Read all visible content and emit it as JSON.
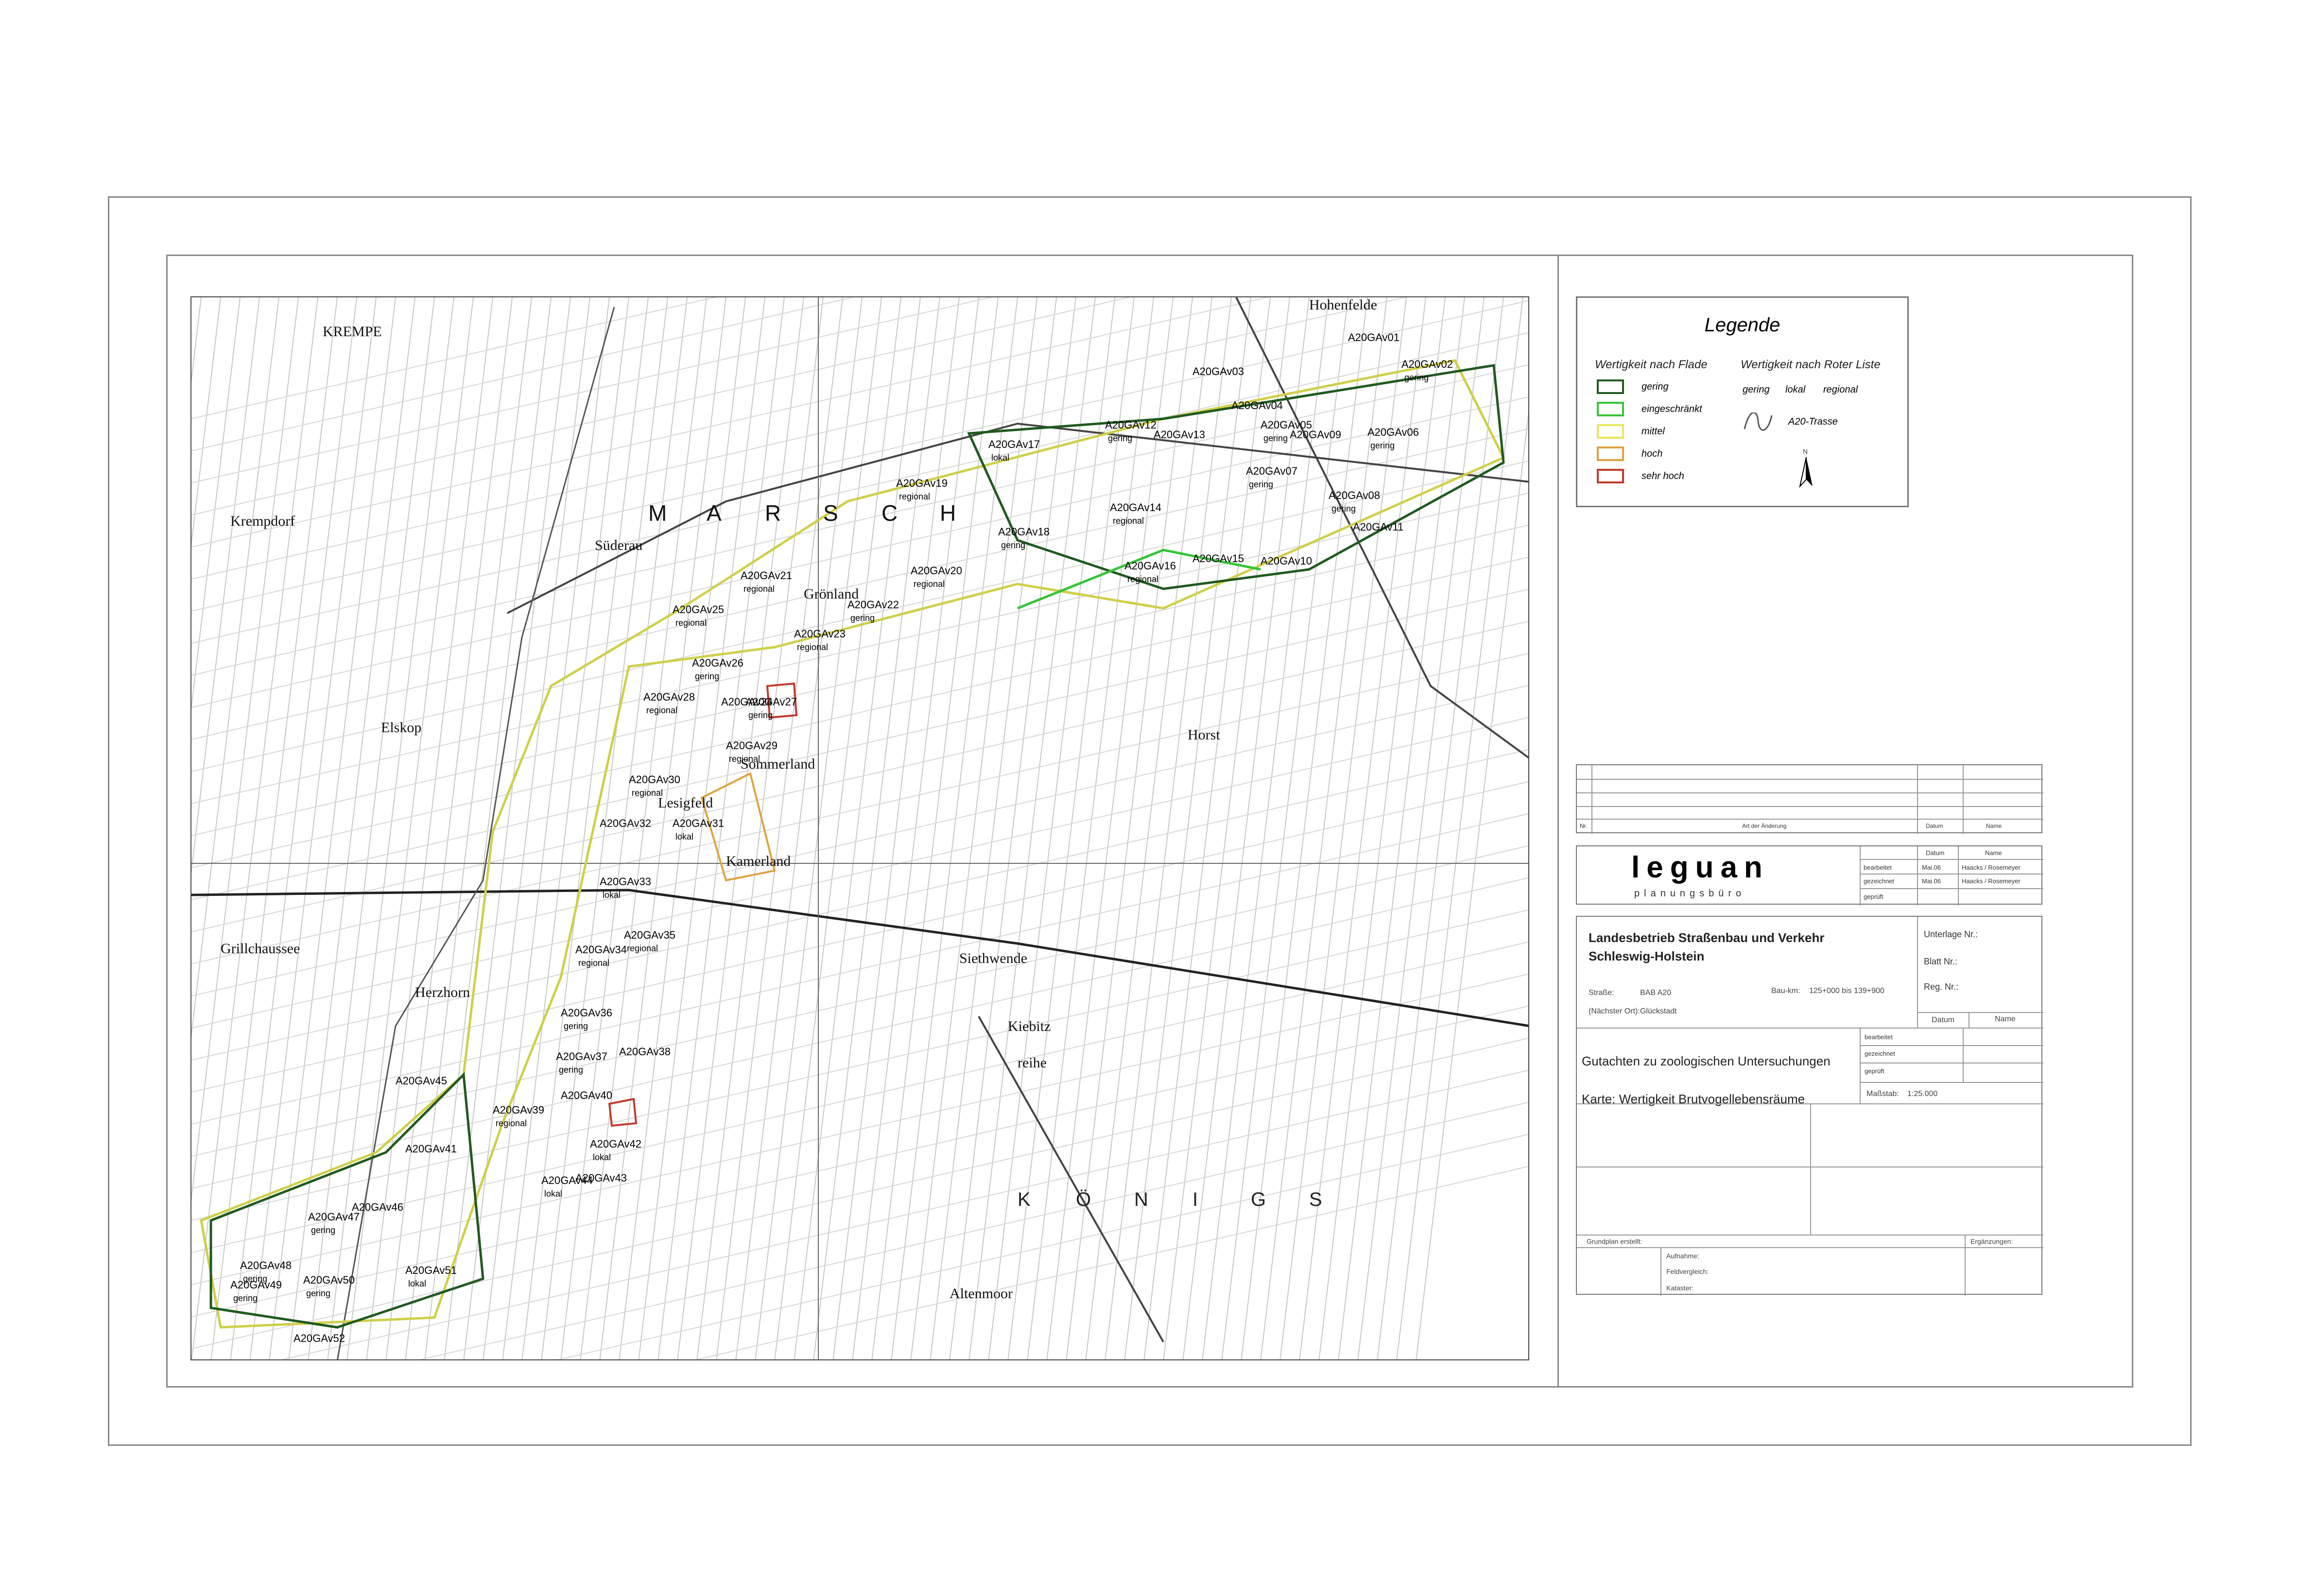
{
  "legend": {
    "title": "Legende",
    "header_flade": "Wertigkeit nach Flade",
    "header_rote_liste": "Wertigkeit nach Roter Liste",
    "categories": [
      {
        "label": "gering",
        "color": "#1f5a1f"
      },
      {
        "label": "eingeschränkt",
        "color": "#36c436"
      },
      {
        "label": "mittel",
        "color": "#e6e65a"
      },
      {
        "label": "hoch",
        "color": "#e0a040"
      },
      {
        "label": "sehr hoch",
        "color": "#c0392b"
      }
    ],
    "rote_liste_levels": [
      "gering",
      "lokal",
      "regional"
    ],
    "trasse_label": "A20-Trasse",
    "north_label": "N"
  },
  "map": {
    "place_names": [
      "KREMPE",
      "Krempdorf",
      "Süderau",
      "Elskop",
      "Sommerland",
      "Herzhorn",
      "Grillchaussee",
      "Kiebitz",
      "reihe",
      "Horst",
      "Hohenfelde",
      "Altenmoor",
      "Grönland",
      "Kamerland",
      "Siethwende",
      "Lesigfeld"
    ],
    "marsch_letters": [
      "M",
      "A",
      "R",
      "S",
      "C",
      "H"
    ],
    "koenigs_letters": [
      "K",
      "Ö",
      "N",
      "I",
      "G",
      "S"
    ],
    "areas": [
      {
        "id": "A20GAv01",
        "rating": ""
      },
      {
        "id": "A20GAv02",
        "rating": "gering"
      },
      {
        "id": "A20GAv03",
        "rating": ""
      },
      {
        "id": "A20GAv04",
        "rating": ""
      },
      {
        "id": "A20GAv05",
        "rating": "gering"
      },
      {
        "id": "A20GAv06",
        "rating": "gering"
      },
      {
        "id": "A20GAv07",
        "rating": "gering"
      },
      {
        "id": "A20GAv08",
        "rating": "gering"
      },
      {
        "id": "A20GAv09",
        "rating": ""
      },
      {
        "id": "A20GAv10",
        "rating": ""
      },
      {
        "id": "A20GAv11",
        "rating": ""
      },
      {
        "id": "A20GAv12",
        "rating": "gering"
      },
      {
        "id": "A20GAv13",
        "rating": ""
      },
      {
        "id": "A20GAv14",
        "rating": "regional"
      },
      {
        "id": "A20GAv15",
        "rating": ""
      },
      {
        "id": "A20GAv16",
        "rating": "regional"
      },
      {
        "id": "A20GAv17",
        "rating": "lokal"
      },
      {
        "id": "A20GAv18",
        "rating": "gering"
      },
      {
        "id": "A20GAv19",
        "rating": "regional"
      },
      {
        "id": "A20GAv20",
        "rating": "regional"
      },
      {
        "id": "A20GAv21",
        "rating": "regional"
      },
      {
        "id": "A20GAv22",
        "rating": "gering"
      },
      {
        "id": "A20GAv23",
        "rating": "regional"
      },
      {
        "id": "A20GAv24",
        "rating": ""
      },
      {
        "id": "A20GAv25",
        "rating": "regional"
      },
      {
        "id": "A20GAv26",
        "rating": "gering"
      },
      {
        "id": "A20GAv27",
        "rating": "gering"
      },
      {
        "id": "A20GAv28",
        "rating": "regional"
      },
      {
        "id": "A20GAv29",
        "rating": "regional"
      },
      {
        "id": "A20GAv30",
        "rating": "regional"
      },
      {
        "id": "A20GAv31",
        "rating": "lokal"
      },
      {
        "id": "A20GAv32",
        "rating": ""
      },
      {
        "id": "A20GAv33",
        "rating": "lokal"
      },
      {
        "id": "A20GAv34",
        "rating": "regional"
      },
      {
        "id": "A20GAv35",
        "rating": "regional"
      },
      {
        "id": "A20GAv36",
        "rating": "gering"
      },
      {
        "id": "A20GAv37",
        "rating": "gering"
      },
      {
        "id": "A20GAv38",
        "rating": ""
      },
      {
        "id": "A20GAv39",
        "rating": "regional"
      },
      {
        "id": "A20GAv40",
        "rating": ""
      },
      {
        "id": "A20GAv41",
        "rating": ""
      },
      {
        "id": "A20GAv42",
        "rating": "lokal"
      },
      {
        "id": "A20GAv43",
        "rating": ""
      },
      {
        "id": "A20GAv44",
        "rating": "lokal"
      },
      {
        "id": "A20GAv45",
        "rating": ""
      },
      {
        "id": "A20GAv46",
        "rating": ""
      },
      {
        "id": "A20GAv47",
        "rating": "gering"
      },
      {
        "id": "A20GAv48",
        "rating": "gering"
      },
      {
        "id": "A20GAv49",
        "rating": "gering"
      },
      {
        "id": "A20GAv50",
        "rating": "gering"
      },
      {
        "id": "A20GAv51",
        "rating": "lokal"
      },
      {
        "id": "A20GAv52",
        "rating": ""
      }
    ]
  },
  "title_block": {
    "rev_col_no": "Nr.",
    "rev_col_change": "Art der Änderung",
    "rev_col_date": "Datum",
    "rev_col_name": "Name",
    "office_name": "leguan",
    "office_sub": "planungsbüro",
    "office_rows": [
      {
        "role": "",
        "date": "Datum",
        "name": "Name"
      },
      {
        "role": "bearbeitet",
        "date": "Mai.06",
        "name": "Haacks / Rosemeyer"
      },
      {
        "role": "gezeichnet",
        "date": "Mai.06",
        "name": "Haacks / Rosemeyer"
      },
      {
        "role": "geprüft",
        "date": "",
        "name": ""
      }
    ],
    "authority_line1": "Landesbetrieb Straßenbau und Verkehr",
    "authority_line2": "Schleswig-Holstein",
    "unterlage": "Unterlage Nr.:",
    "blatt": "Blatt Nr.:",
    "reg": "Reg. Nr.:",
    "strasse_label": "Straße:",
    "strasse_value": "BAB A20",
    "baukm_label": "Bau-km:",
    "baukm_value": "125+000 bis 139+900",
    "ort_label": "(Nächster Ort):",
    "ort_value": "Glückstadt",
    "date_label": "Datum",
    "name_label": "Name",
    "doc_title": "Gutachten zu zoologischen Untersuchungen",
    "map_title": "Karte: Wertigkeit Brutvogellebensräume",
    "approvals": [
      "bearbeitet",
      "gezeichnet",
      "geprüft"
    ],
    "scale_label": "Maßstab:",
    "scale_value": "1:25.000",
    "grundplan": "Grundplan erstellt:",
    "ergaenzungen": "Ergänzungen:",
    "aufnahme": "Aufnahme:",
    "feldvergleich": "Feldvergleich:",
    "kataster": "Kataster:"
  }
}
